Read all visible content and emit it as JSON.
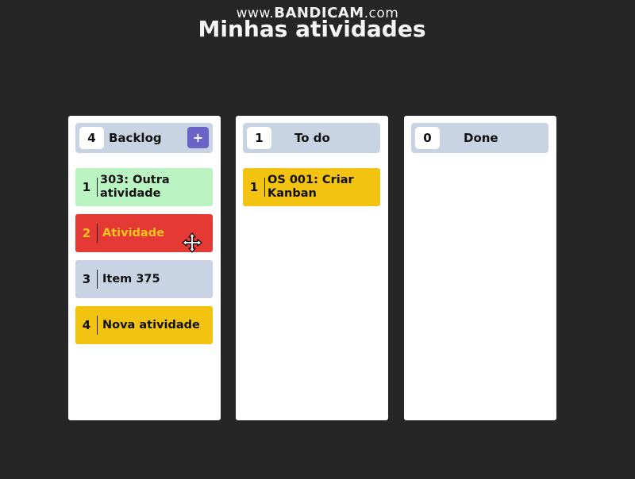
{
  "watermark": {
    "prefix": "www.",
    "brand": "BANDICAM",
    "suffix": ".com"
  },
  "page": {
    "title": "Minhas atividades"
  },
  "columns": [
    {
      "title": "Backlog",
      "count": "4",
      "add_label": "+",
      "cards": [
        {
          "num": "1",
          "text": "303: Outra atividade",
          "color": "#b9f4c2"
        },
        {
          "num": "2",
          "text": "Atividade",
          "color": "#e53935"
        },
        {
          "num": "3",
          "text": "Item 375",
          "color": "#c8d4e3"
        },
        {
          "num": "4",
          "text": "Nova atividade",
          "color": "#f2c311"
        }
      ]
    },
    {
      "title": "To do",
      "count": "1",
      "cards": [
        {
          "num": "1",
          "text": "OS 001: Criar Kanban",
          "color": "#f2c311"
        }
      ]
    },
    {
      "title": "Done",
      "count": "0",
      "cards": []
    }
  ],
  "cursor_icon": "move-cursor-icon"
}
